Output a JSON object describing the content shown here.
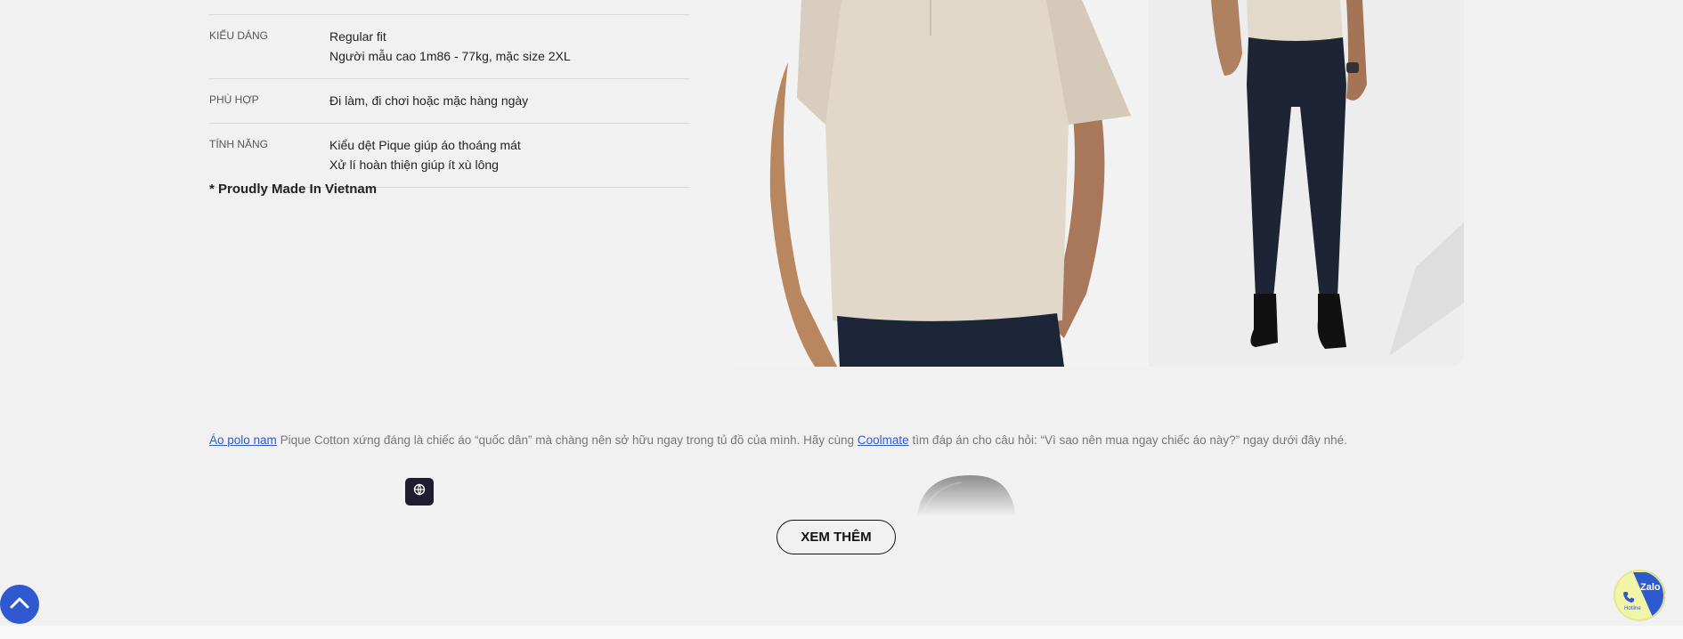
{
  "specs": [
    {
      "key": "KIỂU DÁNG",
      "lines": [
        "Regular fit",
        "Người mẫu cao 1m86 - 77kg, mặc size 2XL"
      ]
    },
    {
      "key": "PHÙ HỢP",
      "lines": [
        "Đi làm, đi chơi hoặc mặc hàng ngày"
      ]
    },
    {
      "key": "TÍNH NĂNG",
      "lines": [
        "Kiểu dệt Pique giúp áo thoáng mát",
        "Xử lí hoàn thiện giúp ít xù lông"
      ]
    }
  ],
  "made_in": "* Proudly Made In Vietnam",
  "description": {
    "link1": "Áo polo nam",
    "text1": " Pique Cotton xứng đáng là chiếc áo “quốc dân” mà chàng nên sở hữu ngay trong tủ đồ của mình. Hãy cùng ",
    "link2": "Coolmate",
    "text2": " tìm đáp án cho câu hỏi: “Vì sao nên mua ngay chiếc áo này?” ngay dưới đây nhé."
  },
  "see_more": "XEM THÊM",
  "zalo": {
    "label": "Zalo",
    "sub": "Hotline"
  },
  "icons": {
    "scroll_top": "chevron-up-icon",
    "chip": "globe-icon",
    "phone": "phone-icon"
  },
  "colors": {
    "accent": "#2f5acf",
    "background": "#f1f1f1"
  }
}
